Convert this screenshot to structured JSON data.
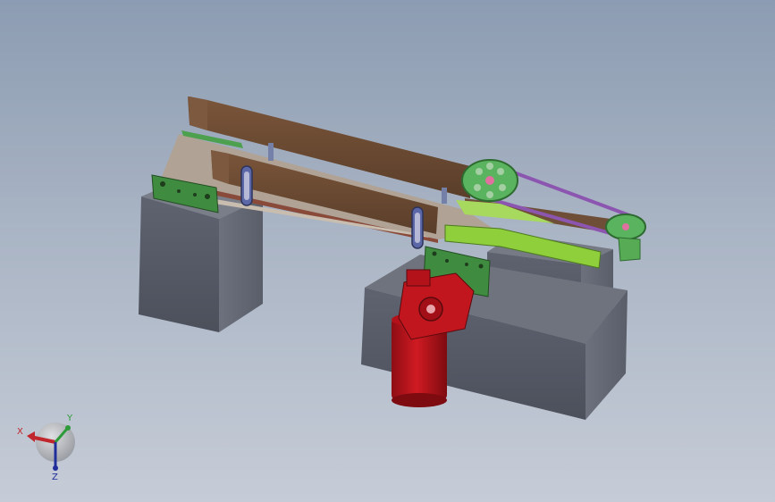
{
  "triad": {
    "x_label": "X",
    "y_label": "Y",
    "z_label": "Z",
    "x_color": "#c0262c",
    "y_color": "#2e9b3a",
    "z_color": "#1f2e9b"
  },
  "colors": {
    "background_top": "#8c9cb2",
    "background_bottom": "#c6ccd7",
    "block": "#5b5f6b",
    "rail": "#6b4a33",
    "plate": "#3d8a3d",
    "motor": "#b8141c",
    "belt": "#7a4fa0",
    "pulley": "#4fae5a"
  }
}
